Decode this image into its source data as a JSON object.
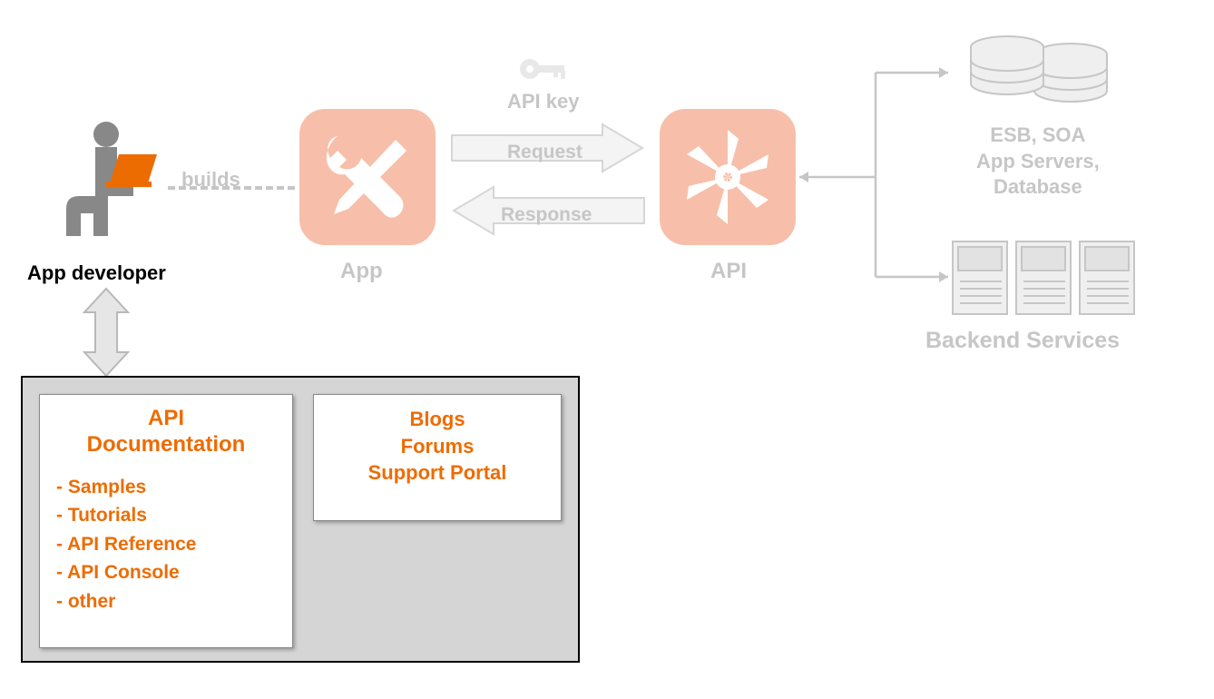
{
  "developer": {
    "label": "App developer"
  },
  "builds": {
    "label": "builds"
  },
  "app": {
    "label": "App"
  },
  "api": {
    "label": "API"
  },
  "center": {
    "api_key": "API key",
    "request": "Request",
    "response": "Response"
  },
  "backend": {
    "title": "Backend Services",
    "esb_line1": "ESB, SOA",
    "esb_line2": "App Servers,",
    "esb_line3": "Database"
  },
  "portal": {
    "api_doc": {
      "title_line1": "API",
      "title_line2": "Documentation",
      "items": [
        "- Samples",
        "- Tutorials",
        "- API Reference",
        "- API Console",
        "- other"
      ]
    },
    "community": {
      "line1": "Blogs",
      "line2": "Forums",
      "line3": "Support Portal"
    }
  }
}
